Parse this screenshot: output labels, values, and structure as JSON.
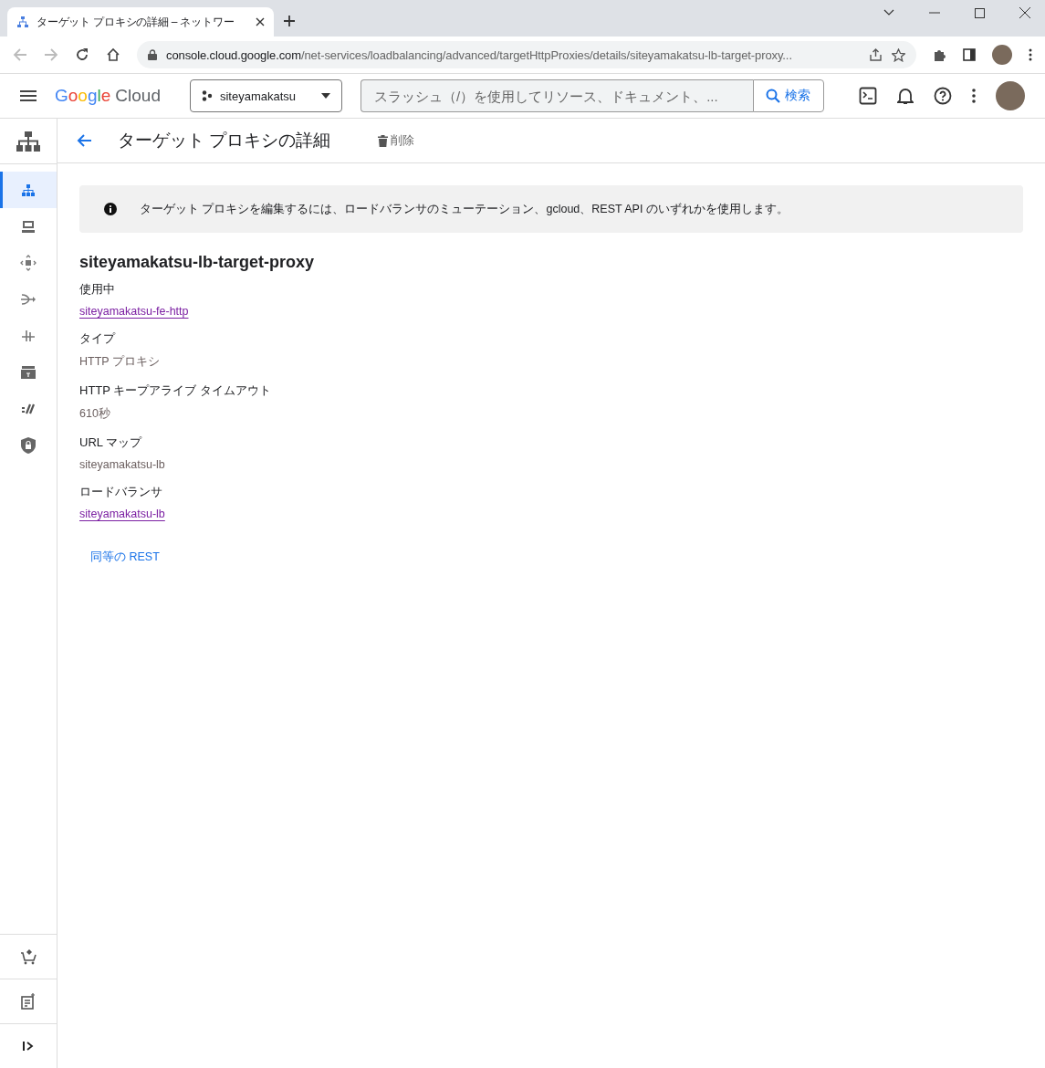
{
  "browser": {
    "tab_title": "ターゲット プロキシの詳細 – ネットワー",
    "url_domain": "console.cloud.google.com",
    "url_path": "/net-services/loadbalancing/advanced/targetHttpProxies/details/siteyamakatsu-lb-target-proxy..."
  },
  "header": {
    "logo_word": "Google",
    "logo_product": "Cloud",
    "project": "siteyamakatsu",
    "search": {
      "placeholder": "スラッシュ（/）を使用してリソース、ドキュメント、..."
    },
    "search_button": "検索"
  },
  "page_header": {
    "title": "ターゲット プロキシの詳細",
    "delete_button": "削除"
  },
  "sidebar": {
    "items": [
      {
        "kind": "hierarchy",
        "selected": true
      },
      {
        "kind": "server",
        "selected": false
      },
      {
        "kind": "move",
        "selected": false
      },
      {
        "kind": "route",
        "selected": false
      },
      {
        "kind": "interconnect",
        "selected": false
      },
      {
        "kind": "storage",
        "selected": false
      },
      {
        "kind": "slashes",
        "selected": false
      },
      {
        "kind": "shield",
        "selected": false
      }
    ],
    "bottom_items": [
      {
        "kind": "cart"
      },
      {
        "kind": "notes"
      },
      {
        "kind": "expand"
      }
    ]
  },
  "info_banner": "ターゲット プロキシを編集するには、ロードバランサのミューテーション、gcloud、REST API のいずれかを使用します。",
  "resource_name": "siteyamakatsu-lb-target-proxy",
  "fields": [
    {
      "label": "使用中",
      "value": "siteyamakatsu-fe-http",
      "kind": "link"
    },
    {
      "label": "タイプ",
      "value": "HTTP プロキシ",
      "kind": "text"
    },
    {
      "label": "HTTP キープアライブ タイムアウト",
      "value": "610秒",
      "kind": "text"
    },
    {
      "label": "URL マップ",
      "value": "siteyamakatsu-lb",
      "kind": "text"
    },
    {
      "label": "ロードバランサ",
      "value": "siteyamakatsu-lb",
      "kind": "link"
    }
  ],
  "rest_link": "同等の REST"
}
